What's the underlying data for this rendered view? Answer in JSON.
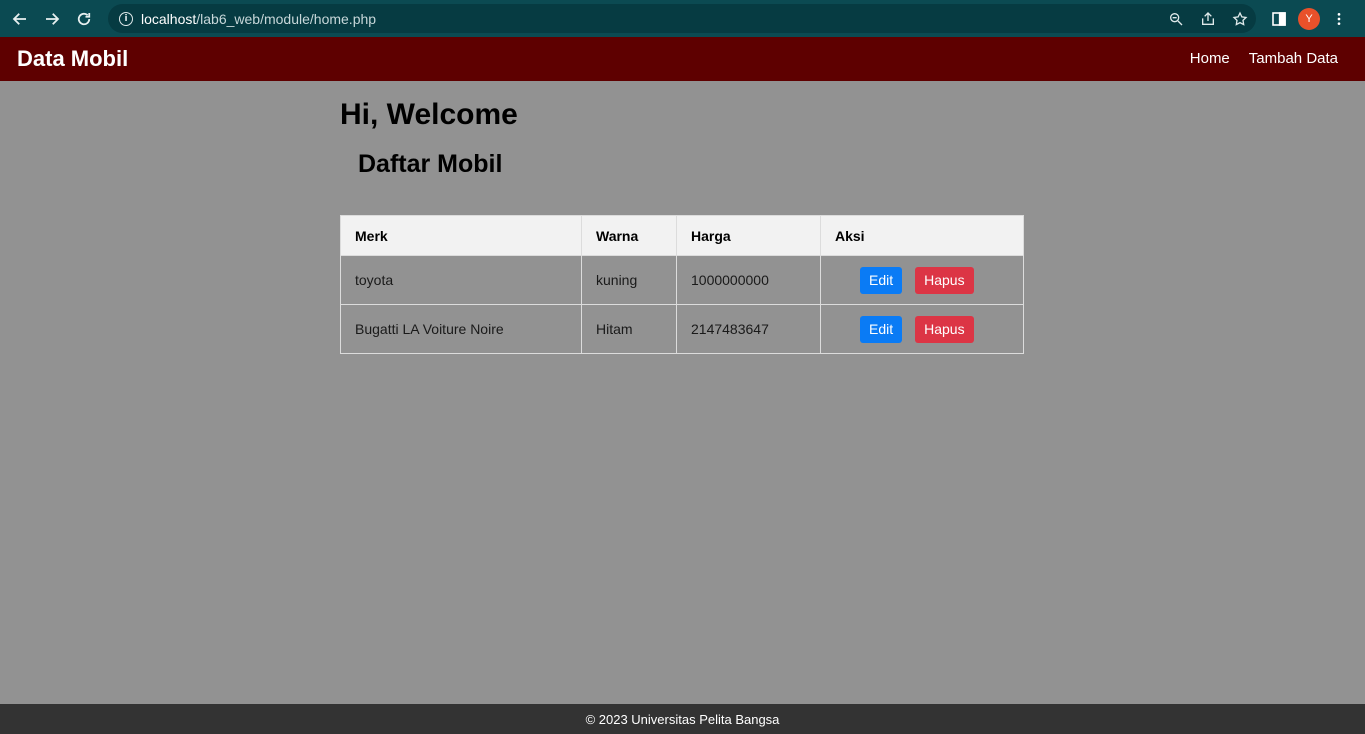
{
  "browser": {
    "url_host": "localhost",
    "url_path": "/lab6_web/module/home.php",
    "profile_initial": "Y"
  },
  "header": {
    "brand": "Data Mobil",
    "nav": [
      {
        "label": "Home"
      },
      {
        "label": "Tambah Data"
      }
    ]
  },
  "main": {
    "welcome": "Hi, Welcome",
    "section_title": "Daftar Mobil",
    "table": {
      "columns": [
        "Merk",
        "Warna",
        "Harga",
        "Aksi"
      ],
      "rows": [
        {
          "merk": "toyota",
          "warna": "kuning",
          "harga": "1000000000",
          "edit": "Edit",
          "delete": "Hapus"
        },
        {
          "merk": "Bugatti LA Voiture Noire",
          "warna": "Hitam",
          "harga": "2147483647",
          "edit": "Edit",
          "delete": "Hapus"
        }
      ]
    }
  },
  "footer": {
    "text": "© 2023 Universitas Pelita Bangsa"
  },
  "colors": {
    "header_bg": "#5e0000",
    "page_bg": "#929292",
    "footer_bg": "#333333",
    "edit_button": "#0a7bf5",
    "delete_button": "#dc3545",
    "browser_chrome": "#0b4a52"
  }
}
